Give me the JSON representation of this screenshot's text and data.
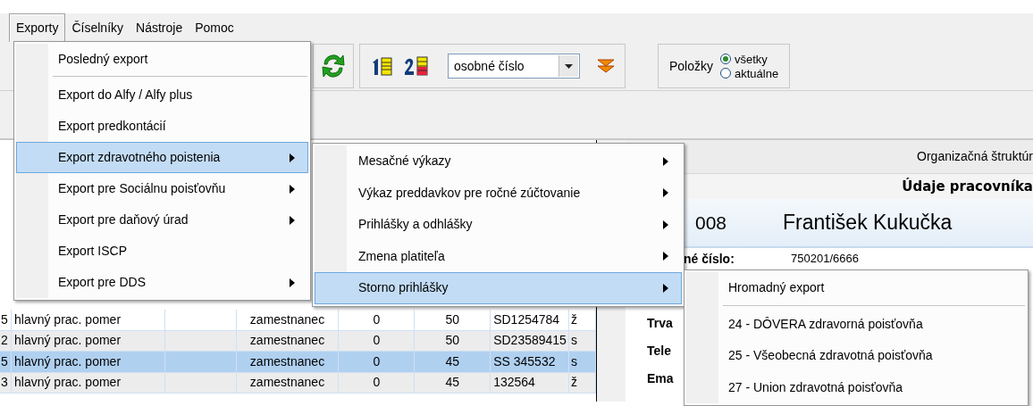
{
  "menu_bar": [
    {
      "label": "Exporty",
      "selected": true
    },
    {
      "label": "Číselníky",
      "selected": false
    },
    {
      "label": "Nástroje",
      "selected": false
    },
    {
      "label": "Pomoc",
      "selected": false
    }
  ],
  "toolbar": {
    "sort_field": "osobné číslo",
    "items_label": "Položky",
    "radios": [
      {
        "label": "všetky",
        "selected": true
      },
      {
        "label": "aktuálne",
        "selected": false
      }
    ]
  },
  "exports_menu": [
    {
      "label": "Posledný export",
      "submenu": false,
      "selected": false,
      "separator_after": true
    },
    {
      "label": "Export do Alfy / Alfy plus",
      "submenu": false,
      "selected": false,
      "separator_after": false
    },
    {
      "label": "Export predkontácií",
      "submenu": false,
      "selected": false,
      "separator_after": false
    },
    {
      "label": "Export zdravotného poistenia",
      "submenu": true,
      "selected": true,
      "separator_after": false
    },
    {
      "label": "Export pre Sociálnu poisťovňu",
      "submenu": true,
      "selected": false,
      "separator_after": false
    },
    {
      "label": "Export pre daňový úrad",
      "submenu": true,
      "selected": false,
      "separator_after": false
    },
    {
      "label": "Export ISCP",
      "submenu": false,
      "selected": false,
      "separator_after": false
    },
    {
      "label": "Export pre DDS",
      "submenu": true,
      "selected": false,
      "separator_after": false
    }
  ],
  "health_submenu": [
    {
      "label": "Mesačné výkazy",
      "submenu": true,
      "selected": false
    },
    {
      "label": "Výkaz preddavkov pre ročné zúčtovanie",
      "submenu": true,
      "selected": false
    },
    {
      "label": "Prihlášky a odhlášky",
      "submenu": true,
      "selected": false
    },
    {
      "label": "Zmena platiteľa",
      "submenu": true,
      "selected": false
    },
    {
      "label": "Storno prihlášky",
      "submenu": true,
      "selected": true
    }
  ],
  "storno_submenu": [
    {
      "label": "Hromadný export",
      "separator_after": true
    },
    {
      "label": "24 - DÔVERA zdravorná poisťovňa",
      "separator_after": false
    },
    {
      "label": "25 - Všeobecná zdravotná poisťovňa",
      "separator_after": false
    },
    {
      "label": "27 - Union zdravotná poisťovňa",
      "separator_after": false
    }
  ],
  "table": {
    "rows": [
      {
        "cells": [
          "5",
          "hlavný prac. pomer",
          "zamestnanec",
          "0",
          "50",
          "SD1254784",
          "ž"
        ],
        "selected": false
      },
      {
        "cells": [
          "2",
          "hlavný prac. pomer",
          "zamestnanec",
          "0",
          "50",
          "SD23589415",
          "s"
        ],
        "selected": false
      },
      {
        "cells": [
          "5",
          "hlavný prac. pomer",
          "zamestnanec",
          "0",
          "45",
          "SS 345532",
          "s"
        ],
        "selected": true
      },
      {
        "cells": [
          "3",
          "hlavný prac. pomer",
          "zamestnanec",
          "0",
          "45",
          "132564",
          "ž"
        ],
        "selected": false
      }
    ]
  },
  "employee_panel": {
    "org_label": "Organizačná štruktúr",
    "heading": "Údaje pracovníka",
    "number": "008",
    "name": "František Kukučka",
    "birth_label": "né číslo:",
    "birth_value": "750201/6666",
    "field_labels": [
      "Trva",
      "Tele",
      "Ema"
    ]
  }
}
